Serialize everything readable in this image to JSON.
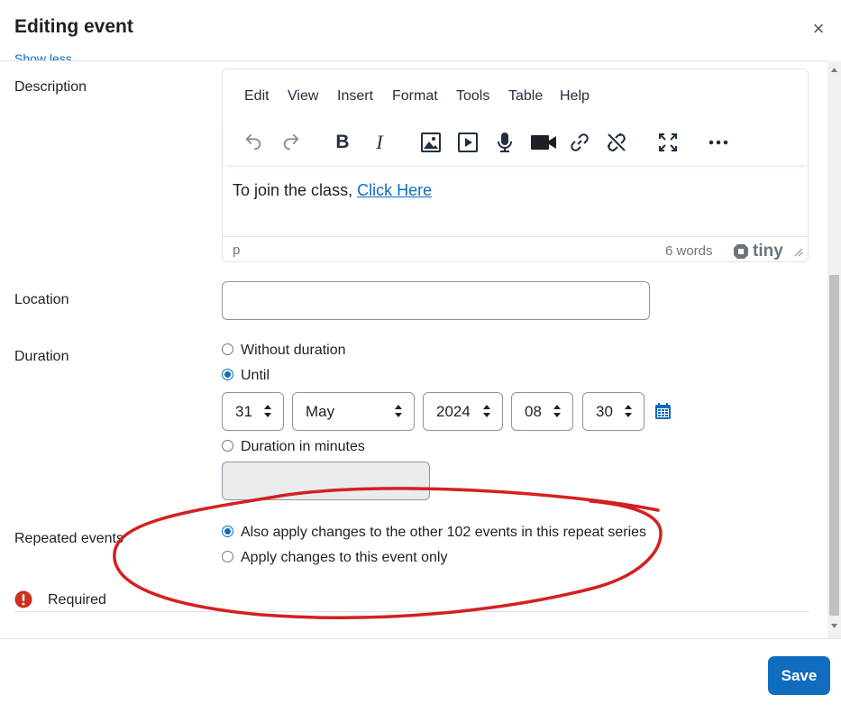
{
  "header": {
    "title": "Editing event",
    "close_label": "×",
    "show_less": "Show less..."
  },
  "form": {
    "description_label": "Description",
    "location_label": "Location",
    "duration_label": "Duration",
    "repeated_label": "Repeated events",
    "required_label": "Required"
  },
  "editor": {
    "menu": [
      "Edit",
      "View",
      "Insert",
      "Format",
      "Tools",
      "Table",
      "Help"
    ],
    "content_prefix": "To join the class, ",
    "content_link": "Click Here",
    "status_path": "p",
    "word_count": "6 words",
    "brand": "tiny"
  },
  "location": {
    "value": ""
  },
  "duration": {
    "options": [
      "Without duration",
      "Until",
      "Duration in minutes"
    ],
    "selected": "Until",
    "day": "31",
    "month": "May",
    "year": "2024",
    "hour": "08",
    "minute": "30",
    "minutes_value": ""
  },
  "repeat": {
    "options": [
      "Also apply changes to the other 102 events in this repeat series",
      "Apply changes to this event only"
    ],
    "selected": "Also apply changes to the other 102 events in this repeat series"
  },
  "footer": {
    "save_label": "Save"
  },
  "colors": {
    "accent": "#0f6cbf",
    "annotation": "#d42020",
    "required_icon": "#ca3120"
  }
}
